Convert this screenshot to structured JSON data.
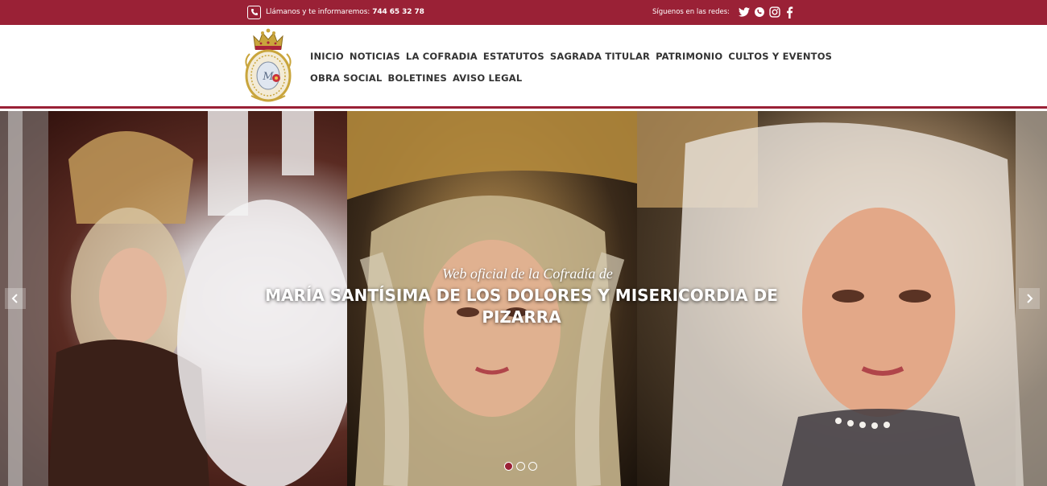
{
  "topbar": {
    "phone_label": "Llámanos y te informaremos:",
    "phone_number": "744 65 32 78",
    "social_label": "Síguenos en las redes:",
    "social_icons": [
      "twitter-icon",
      "whatsapp-icon",
      "instagram-icon",
      "facebook-icon"
    ]
  },
  "nav": {
    "row1": [
      "INICIO",
      "NOTICIAS",
      "LA COFRADIA",
      "ESTATUTOS",
      "SAGRADA TITULAR",
      "PATRIMONIO",
      "CULTOS Y EVENTOS"
    ],
    "row2": [
      "OBRA SOCIAL",
      "BOLETINES",
      "AVISO LEGAL"
    ]
  },
  "slider": {
    "subtitle": "Web oficial de la Cofradía de",
    "title": "MARÍA SANTÍSIMA DE LOS DOLORES Y MISERICORDIA DE PIZARRA",
    "dot_count": 3,
    "active_dot": 0
  },
  "colors": {
    "brand": "#9a2136",
    "nav_text": "#333333"
  }
}
